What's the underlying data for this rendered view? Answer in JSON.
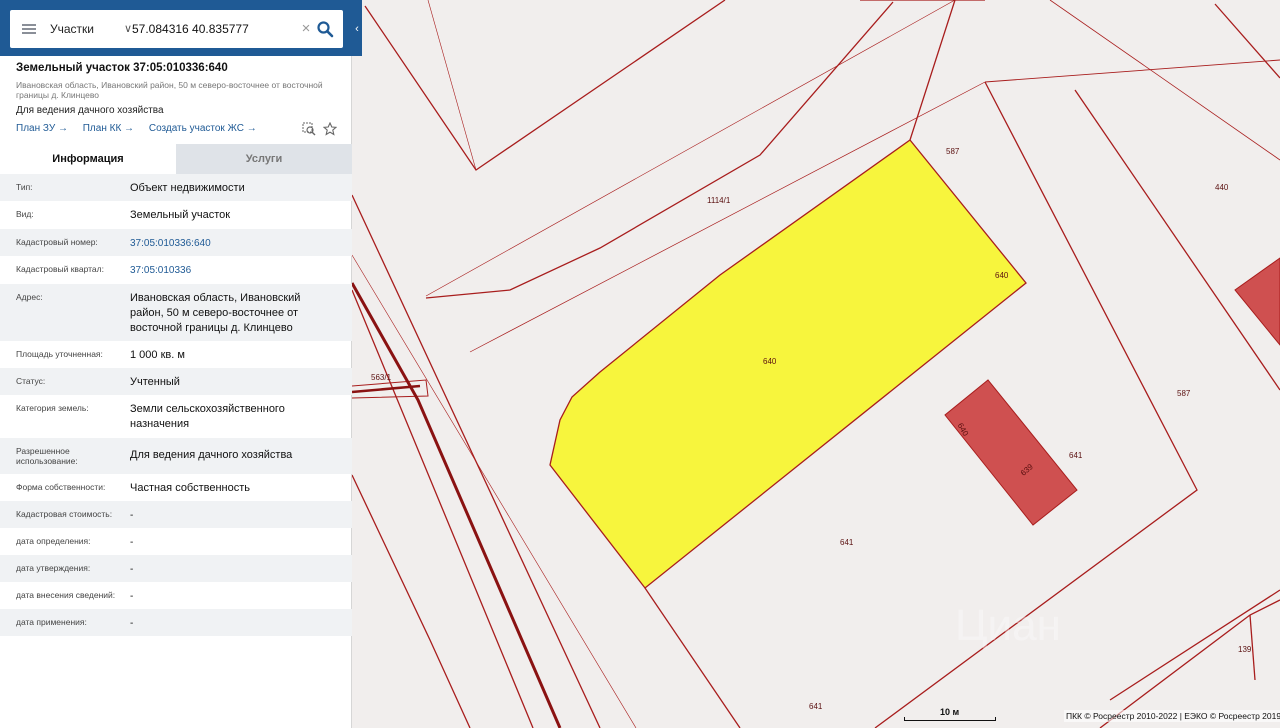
{
  "search": {
    "layer": "Участки",
    "query": "57.084316 40.835777"
  },
  "object": {
    "title": "Земельный участок 37:05:010336:640",
    "address": "Ивановская область, Ивановский район, 50 м северо-восточнее от восточной границы д. Клинцево",
    "use": "Для ведения дачного хозяйства",
    "links": [
      "План ЗУ",
      "План КК",
      "Создать участок ЖС"
    ]
  },
  "tabs": [
    "Информация",
    "Услуги"
  ],
  "rows": [
    {
      "key": "Тип:",
      "value": "Объект недвижимости"
    },
    {
      "key": "Вид:",
      "value": "Земельный участок"
    },
    {
      "key": "Кадастровый номер:",
      "value": "37:05:010336:640"
    },
    {
      "key": "Кадастровый квартал:",
      "value": "37:05:010336"
    },
    {
      "key": "Адрес:",
      "value": "Ивановская область, Ивановский район, 50 м северо-восточнее от восточной границы д. Клинцево"
    },
    {
      "key": "Площадь уточненная:",
      "value": "1 000 кв. м"
    },
    {
      "key": "Статус:",
      "value": "Учтенный"
    },
    {
      "key": "Категория земель:",
      "value": "Земли сельскохозяйственного назначения"
    },
    {
      "key": "Разрешенное использование:",
      "value": "Для ведения дачного хозяйства"
    },
    {
      "key": "Форма собственности:",
      "value": "Частная собственность"
    },
    {
      "key": "Кадастровая стоимость:",
      "value": "-"
    },
    {
      "key": "дата определения:",
      "value": "-"
    },
    {
      "key": "дата утверждения:",
      "value": "-"
    },
    {
      "key": "дата внесения сведений:",
      "value": "-"
    },
    {
      "key": "дата применения:",
      "value": "-"
    }
  ],
  "map": {
    "labels": {
      "l587a": "587",
      "l440": "440",
      "l1114": "1114/1",
      "l640a": "640",
      "l640b": "640",
      "l563": "563/1",
      "l587b": "587",
      "l641a": "641",
      "l639": "639",
      "l640c": "640",
      "l641b": "641",
      "l641c": "641",
      "l139": "139"
    },
    "scale": "10 м",
    "copyright": "ПКК © Росреестр 2010-2022 | ЕЭКО © Росреестр 2019",
    "colors": {
      "selected_fill": "#f7f53d",
      "building_fill": "#cf5050",
      "boundary": "#a81d1d"
    }
  }
}
